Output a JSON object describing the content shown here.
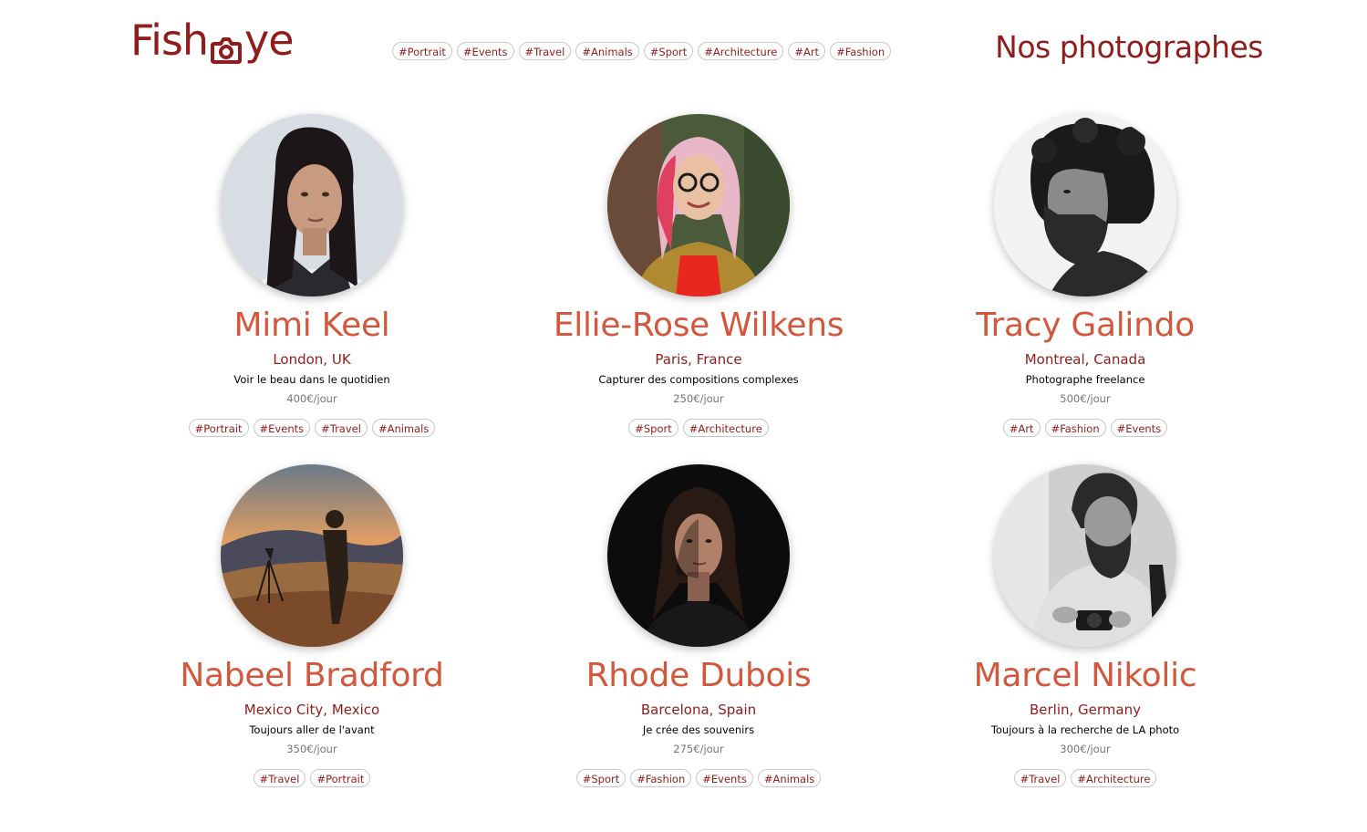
{
  "header": {
    "logo_left": "Fish",
    "logo_right": "ye",
    "title": "Nos photographes",
    "tags": [
      "#Portrait",
      "#Events",
      "#Travel",
      "#Animals",
      "#Sport",
      "#Architecture",
      "#Art",
      "#Fashion"
    ]
  },
  "photographers": [
    {
      "name": "Mimi Keel",
      "location": "London, UK",
      "tagline": "Voir le beau dans le quotidien",
      "price": "400€/jour",
      "tags": [
        "#Portrait",
        "#Events",
        "#Travel",
        "#Animals"
      ]
    },
    {
      "name": "Ellie-Rose Wilkens",
      "location": "Paris, France",
      "tagline": "Capturer des compositions complexes",
      "price": "250€/jour",
      "tags": [
        "#Sport",
        "#Architecture"
      ]
    },
    {
      "name": "Tracy Galindo",
      "location": "Montreal, Canada",
      "tagline": "Photographe freelance",
      "price": "500€/jour",
      "tags": [
        "#Art",
        "#Fashion",
        "#Events"
      ]
    },
    {
      "name": "Nabeel Bradford",
      "location": "Mexico City, Mexico",
      "tagline": "Toujours aller de l'avant",
      "price": "350€/jour",
      "tags": [
        "#Travel",
        "#Portrait"
      ]
    },
    {
      "name": "Rhode Dubois",
      "location": "Barcelona, Spain",
      "tagline": "Je crée des souvenirs",
      "price": "275€/jour",
      "tags": [
        "#Sport",
        "#Fashion",
        "#Events",
        "#Animals"
      ]
    },
    {
      "name": "Marcel Nikolic",
      "location": "Berlin, Germany",
      "tagline": "Toujours à la recherche de LA photo",
      "price": "300€/jour",
      "tags": [
        "#Travel",
        "#Architecture"
      ]
    }
  ],
  "colors": {
    "primary": "#901c1c",
    "name": "#d3573c",
    "price": "#757575"
  }
}
